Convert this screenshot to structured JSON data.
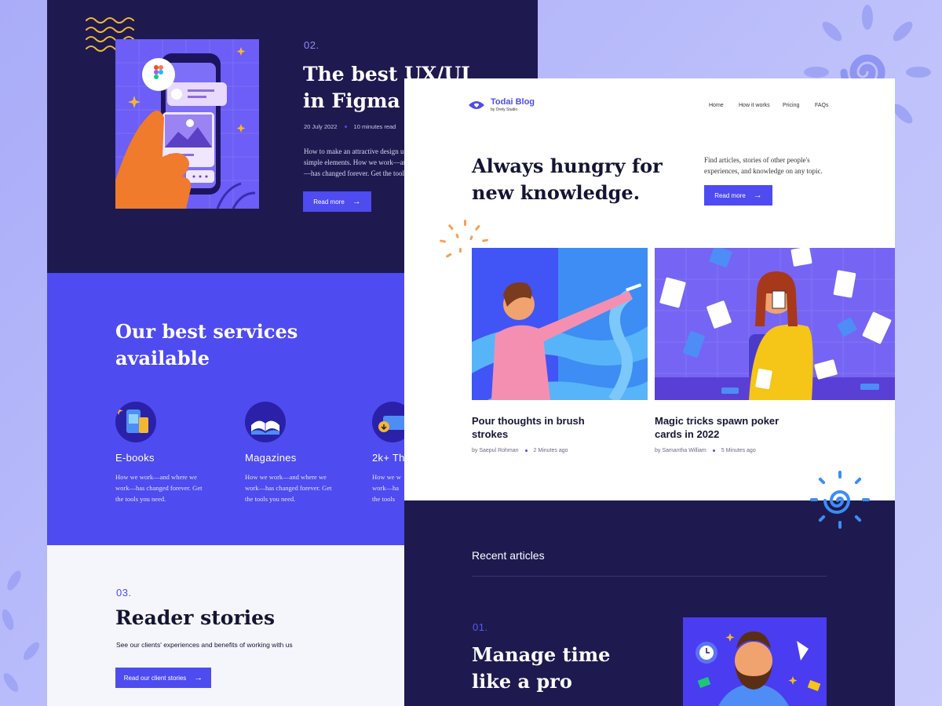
{
  "left": {
    "hero": {
      "number": "02.",
      "title_line1": "The best UX/UI",
      "title_line2": "in Figma",
      "date": "20 July 2022",
      "read_time": "10 minutes read",
      "desc_line1": "How to make an attractive design u",
      "desc_line2": "simple elements. How we work—and",
      "desc_line3": "—has changed forever. Get the tools",
      "button": "Read more"
    },
    "services": {
      "title_line1": "Our best services",
      "title_line2": "available",
      "items": [
        {
          "title": "E-books",
          "desc_line1": "How we work—and where we",
          "desc_line2": "work—has changed forever. Get",
          "desc_line3": "the tools you need."
        },
        {
          "title": "Magazines",
          "desc_line1": "How we work—and where we",
          "desc_line2": "work—has changed forever. Get",
          "desc_line3": "the tools you need."
        },
        {
          "title": "2k+ Th",
          "desc_line1": "How we w",
          "desc_line2": "work—ha",
          "desc_line3": "the tools"
        }
      ]
    },
    "stories": {
      "number": "03.",
      "title": "Reader stories",
      "subtitle": "See our clients' experiences and benefits of working with us",
      "button": "Read our client stories"
    }
  },
  "right": {
    "brand": {
      "name": "Todai Blog",
      "sub": "by Orely Studio"
    },
    "nav": [
      "Home",
      "How it works",
      "Pricing",
      "FAQs"
    ],
    "hero": {
      "title_line1": "Always hungry for",
      "title_line2": "new knowledge.",
      "desc_line1": "Find articles, stories of other people's",
      "desc_line2": "experiences, and knowledge on any topic.",
      "button": "Read more"
    },
    "cards": [
      {
        "title_line1": "Pour thoughts in brush",
        "title_line2": "strokes",
        "author": "by Saepul Rohman",
        "time": "2 Minutes ago"
      },
      {
        "title_line1": "Magic tricks spawn poker",
        "title_line2": "cards in 2022",
        "author": "by Samantha William",
        "time": "5 Minutes ago"
      }
    ],
    "recent": {
      "heading": "Recent articles",
      "number": "01.",
      "title_line1": "Manage time",
      "title_line2": "like a pro"
    }
  },
  "colors": {
    "accent": "#4e4bf0",
    "dark": "#1e1a4f",
    "orange": "#f5a05a"
  }
}
